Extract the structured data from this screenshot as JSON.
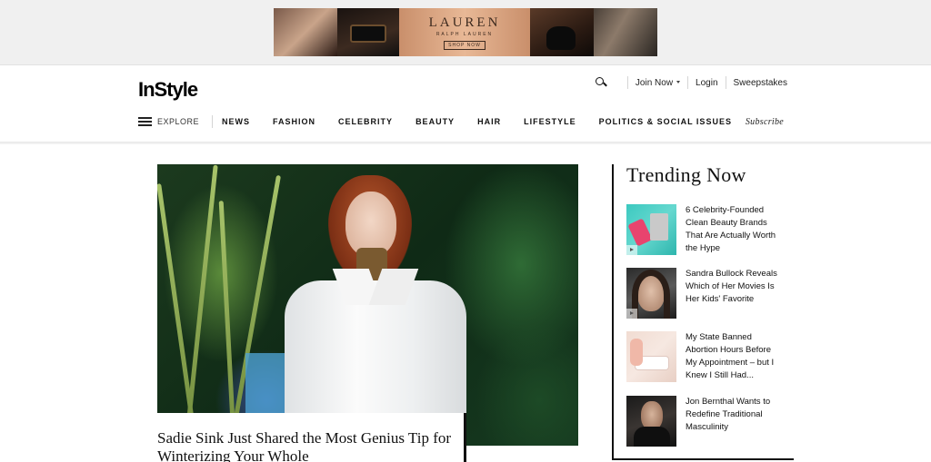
{
  "ad": {
    "brand": "LAUREN",
    "subbrand": "RALPH LAUREN",
    "cta": "SHOP NOW"
  },
  "header": {
    "logo": "InStyle",
    "join_now": "Join Now",
    "login": "Login",
    "sweepstakes": "Sweepstakes",
    "explore": "EXPLORE",
    "subscribe": "Subscribe",
    "nav_items": [
      "NEWS",
      "FASHION",
      "CELEBRITY",
      "BEAUTY",
      "HAIR",
      "LIFESTYLE",
      "POLITICS & SOCIAL ISSUES"
    ]
  },
  "hero": {
    "caption": "Sadie Sink Just Shared the Most Genius Tip for Winterizing Your Whole"
  },
  "trending": {
    "title": "Trending Now",
    "items": [
      {
        "title": "6 Celebrity-Founded Clean Beauty Brands That Are Actually Worth the Hype",
        "has_video": true
      },
      {
        "title": "Sandra Bullock Reveals Which of Her Movies Is Her Kids' Favorite",
        "has_video": true
      },
      {
        "title": "My State Banned Abortion Hours Before My Appointment – but I Knew I Still Had...",
        "has_video": false
      },
      {
        "title": "Jon Bernthal Wants to Redefine Traditional Masculinity",
        "has_video": false
      }
    ]
  },
  "icons": {
    "search": "search-icon",
    "menu": "hamburger-icon",
    "dropdown": "chevron-down-icon",
    "play": "play-icon"
  }
}
